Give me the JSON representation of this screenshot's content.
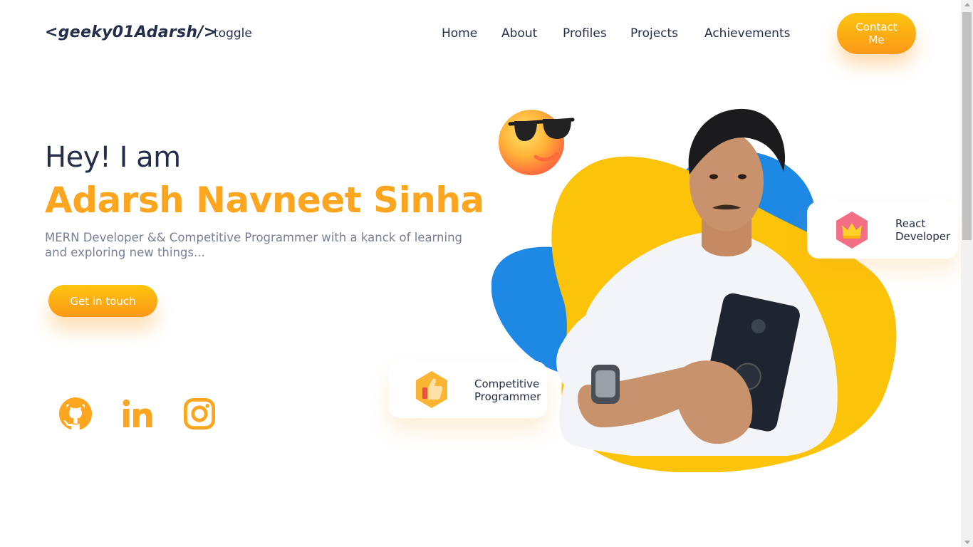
{
  "nav": {
    "logo": "<geeky01Adarsh/>",
    "toggle": "toggle",
    "links": [
      "Home",
      "About",
      "Profiles",
      "Projects",
      "Achievements"
    ],
    "contact_label": "Contact Me"
  },
  "hero": {
    "greeting": "Hey! I am",
    "name": "Adarsh Navneet Sinha",
    "description": "MERN Developer && Competitive Programmer with a kanck of learning and exploring new things...",
    "cta_label": "Get in touch"
  },
  "socials": [
    {
      "icon": "github-icon"
    },
    {
      "icon": "linkedin-icon"
    },
    {
      "icon": "instagram-icon"
    }
  ],
  "badges": {
    "react": {
      "icon": "crown-icon",
      "line1": "React",
      "line2": "Developer"
    },
    "cp": {
      "icon": "thumbs-up-icon",
      "line1": "Competitive",
      "line2": "Programmer"
    }
  },
  "colors": {
    "accent": "#fca61f",
    "text": "#242d49",
    "muted": "#788097",
    "blob_blue": "#1e88e5",
    "blob_yellow": "#fcc30b"
  }
}
